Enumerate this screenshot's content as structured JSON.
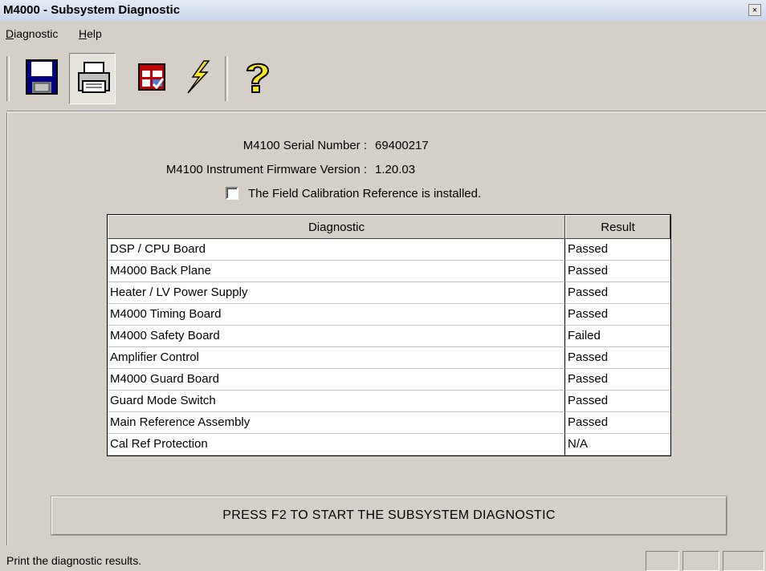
{
  "window": {
    "title": "M4000 - Subsystem Diagnostic",
    "close_glyph": "×"
  },
  "menu": [
    {
      "label_underlined": "D",
      "label_rest": "iagnostic"
    },
    {
      "label_underlined": "H",
      "label_rest": "elp"
    }
  ],
  "toolbar": {
    "buttons": [
      {
        "icon": "floppy-disk-save-icon"
      },
      {
        "icon": "printer-icon",
        "pressed": true
      },
      {
        "icon": "calendar-checkbox-icon"
      },
      {
        "icon": "lightning-bolt-icon"
      },
      {
        "icon": "question-mark-help-icon"
      }
    ]
  },
  "info": {
    "serial_label": "M4100 Serial Number :",
    "serial_value": "69400217",
    "firmware_label": "M4100 Instrument Firmware Version :",
    "firmware_value": "1.20.03",
    "calref_label": "The Field Calibration Reference is installed.",
    "calref_checked": false
  },
  "table": {
    "headers": [
      "Diagnostic",
      "Result"
    ],
    "rows": [
      {
        "diagnostic": "DSP / CPU Board",
        "result": "Passed"
      },
      {
        "diagnostic": "M4000 Back Plane",
        "result": "Passed"
      },
      {
        "diagnostic": "Heater / LV Power Supply",
        "result": "Passed"
      },
      {
        "diagnostic": "M4000 Timing Board",
        "result": "Passed"
      },
      {
        "diagnostic": "M4000 Safety Board",
        "result": "Failed"
      },
      {
        "diagnostic": "Amplifier Control",
        "result": "Passed"
      },
      {
        "diagnostic": "M4000 Guard Board",
        "result": "Passed"
      },
      {
        "diagnostic": "Guard Mode Switch",
        "result": "Passed"
      },
      {
        "diagnostic": "Main Reference Assembly",
        "result": "Passed"
      },
      {
        "diagnostic": "Cal Ref Protection",
        "result": "N/A"
      }
    ]
  },
  "start_button": {
    "label": "PRESS F2 TO START THE SUBSYSTEM DIAGNOSTIC"
  },
  "status": {
    "text": "Print the diagnostic results."
  },
  "colors": {
    "window_bg": "#d4d0c8",
    "titlebar": "#c9d6ec"
  }
}
